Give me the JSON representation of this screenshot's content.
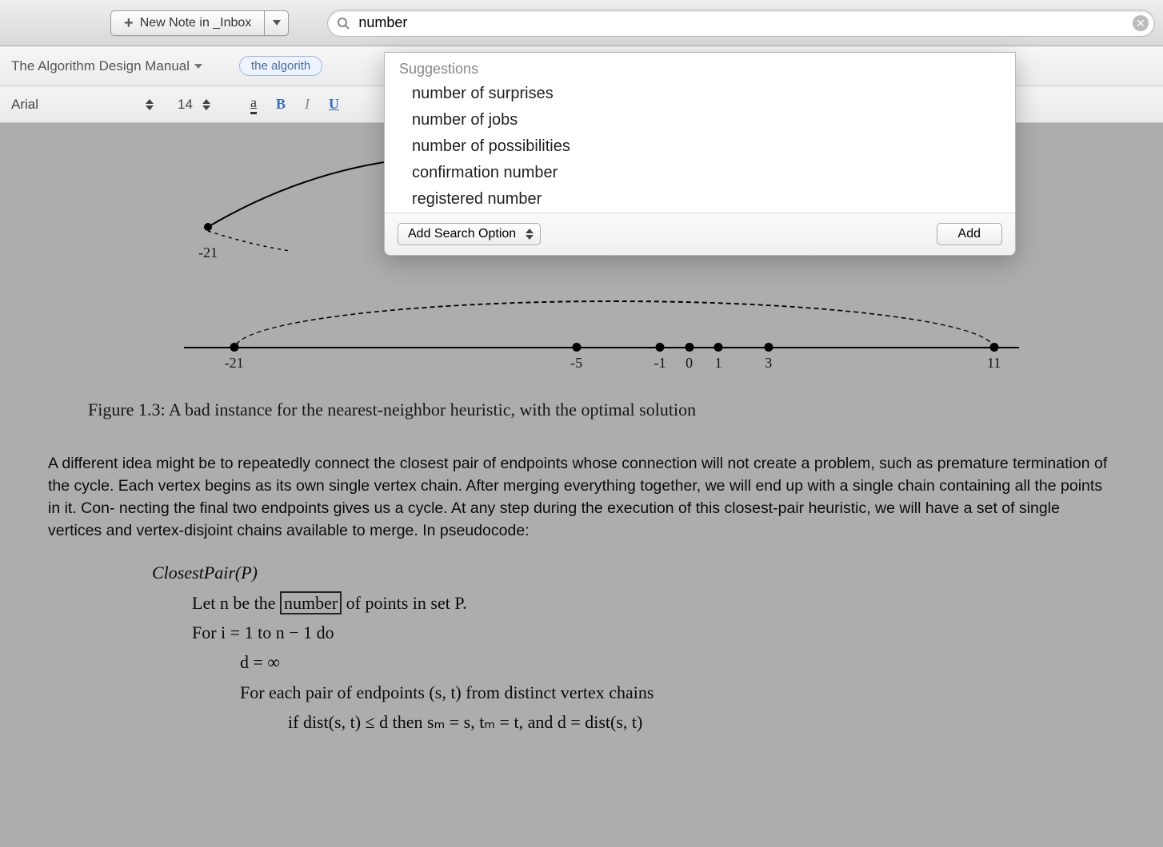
{
  "toolbar": {
    "new_note_label": "New Note in _Inbox",
    "search_value": "number"
  },
  "notebook": {
    "name": "The Algorithm Design Manual",
    "tag": "the algorith"
  },
  "format": {
    "font": "Arial",
    "size": "14",
    "a": "a",
    "b": "B",
    "i": "I",
    "u": "U"
  },
  "suggestions": {
    "header": "Suggestions",
    "items": [
      "number of surprises",
      "number of jobs",
      "number of possibilities",
      "confirmation number",
      "registered number"
    ],
    "add_option_label": "Add Search Option",
    "add_label": "Add"
  },
  "figure": {
    "top_point_label": "-21",
    "numline_points": [
      {
        "label": "-21",
        "pos": 6
      },
      {
        "label": "-5",
        "pos": 47
      },
      {
        "label": "-1",
        "pos": 57
      },
      {
        "label": "0",
        "pos": 60.5
      },
      {
        "label": "1",
        "pos": 64
      },
      {
        "label": "3",
        "pos": 70
      },
      {
        "label": "11",
        "pos": 97
      }
    ],
    "caption": "Figure 1.3: A bad instance for the nearest-neighbor heuristic, with the optimal solution"
  },
  "paragraph": "A different idea might be to repeatedly connect the closest pair of endpoints whose connection will not create a problem, such as premature termination of the cycle. Each vertex begins as its own single vertex chain. After merging everything together, we will end up with a single chain containing all the points in it. Con- necting the final two endpoints gives us a cycle. At any step during the execution of this closest-pair heuristic, we will have a set of single vertices and vertex-disjoint chains available to merge. In pseudocode:",
  "pseudo": {
    "title": "ClosestPair(P)",
    "line_let_pre": "Let n be the ",
    "highlight": "number",
    "line_let_post": " of points in set P.",
    "line_for": "For i = 1 to n − 1 do",
    "line_d": "d = ∞",
    "line_each": "For each pair of endpoints (s, t) from distinct vertex chains",
    "line_if": "if dist(s, t) ≤ d then sₘ = s, tₘ = t, and d = dist(s, t)"
  }
}
